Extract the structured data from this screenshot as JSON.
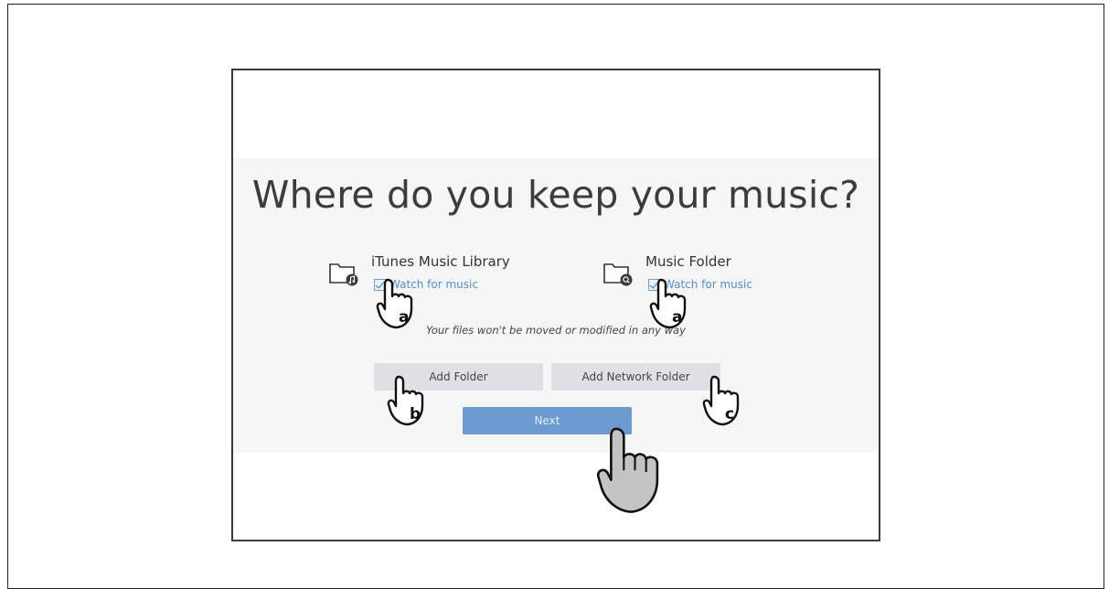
{
  "dialog": {
    "title": "Where do you keep your music?",
    "options": [
      {
        "name": "iTunes Music Library",
        "icon": "itunes-folder-icon",
        "watch_label": "Watch for music",
        "watch_checked": true
      },
      {
        "name": "Music Folder",
        "icon": "music-folder-icon",
        "watch_label": "Watch for music",
        "watch_checked": true
      }
    ],
    "note": "Your files won't be moved or modified in any way",
    "buttons": {
      "add_folder": "Add Folder",
      "add_network_folder": "Add Network Folder",
      "next": "Next"
    }
  },
  "callouts": {
    "a": "a",
    "b": "b",
    "c": "c"
  },
  "colors": {
    "accent": "#6a9cd2",
    "link": "#4f8fd6",
    "button_gray": "#dfe1e5",
    "panel_bg": "#f6f6f7"
  }
}
